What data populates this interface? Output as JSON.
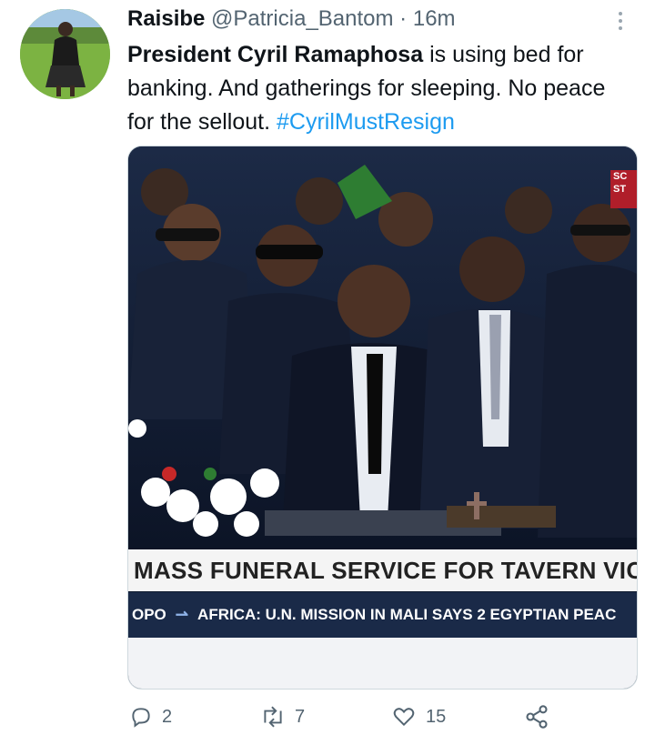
{
  "tweet": {
    "display_name": "Raisibe",
    "handle": "@Patricia_Bantom",
    "separator": "·",
    "time": "16m",
    "text": {
      "bold_part": "President Cyril Ramaphosa",
      "rest": " is using bed for banking. And gatherings for sleeping.  No peace for the sellout. ",
      "hashtag": "#CyrilMustResign"
    }
  },
  "media": {
    "chyron": "MASS FUNERAL SERVICE FOR TAVERN VIC",
    "ticker_prefix": "OPO",
    "ticker_text": "AFRICA: U.N. MISSION IN MALI SAYS 2 EGYPTIAN PEAC",
    "badge_line1": "SC",
    "badge_line2": "ST"
  },
  "actions": {
    "reply_count": "2",
    "retweet_count": "7",
    "like_count": "15"
  },
  "colors": {
    "accent": "#1d9bf0",
    "muted": "#536471",
    "text": "#0f1419"
  }
}
